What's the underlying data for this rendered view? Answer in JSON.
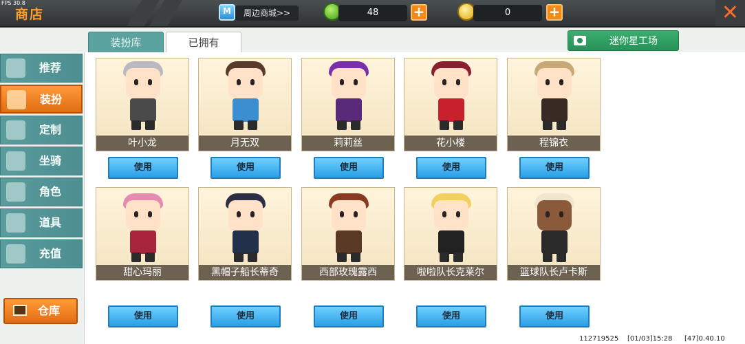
{
  "top_bar": {
    "fps": "FPS 30.8",
    "title": "商店",
    "mall_link": "周边商城>>",
    "currency_green": "48",
    "currency_gold": "0",
    "plus_label": "+",
    "close_label": "✕"
  },
  "tabs": [
    {
      "label": "装扮库",
      "active": false
    },
    {
      "label": "已拥有",
      "active": true
    }
  ],
  "studio_button": "迷你星工场",
  "sidebar": {
    "items": [
      {
        "label": "推荐",
        "icon": "thumbs-up-icon",
        "active": false
      },
      {
        "label": "装扮",
        "icon": "costume-icon",
        "active": true
      },
      {
        "label": "定制",
        "icon": "brush-icon",
        "active": false
      },
      {
        "label": "坐骑",
        "icon": "mount-icon",
        "active": false
      },
      {
        "label": "角色",
        "icon": "character-icon",
        "active": false
      },
      {
        "label": "道具",
        "icon": "item-icon",
        "active": false
      },
      {
        "label": "充值",
        "icon": "coins-icon",
        "active": false
      }
    ],
    "warehouse": "仓库"
  },
  "skins": [
    {
      "name": "叶小龙",
      "button": "使用"
    },
    {
      "name": "月无双",
      "button": "使用"
    },
    {
      "name": "莉莉丝",
      "button": "使用"
    },
    {
      "name": "花小楼",
      "button": "使用"
    },
    {
      "name": "程锦衣",
      "button": "使用"
    },
    {
      "name": "甜心玛丽",
      "button": "使用"
    },
    {
      "name": "黑帽子船长蒂奇",
      "button": "使用"
    },
    {
      "name": "西部玫瑰露西",
      "button": "使用"
    },
    {
      "name": "啦啦队长克莱尔",
      "button": "使用"
    },
    {
      "name": "篮球队长卢卡斯",
      "button": "使用"
    }
  ],
  "footer": {
    "id": "112719525",
    "time": "[01/03]15:28",
    "version": "[47]0.40.10"
  },
  "colors": {
    "accent_orange": "#f28a1a",
    "tab_teal": "#5aa3a0",
    "use_button_blue": "#2a9fe6",
    "studio_green": "#27925a"
  }
}
